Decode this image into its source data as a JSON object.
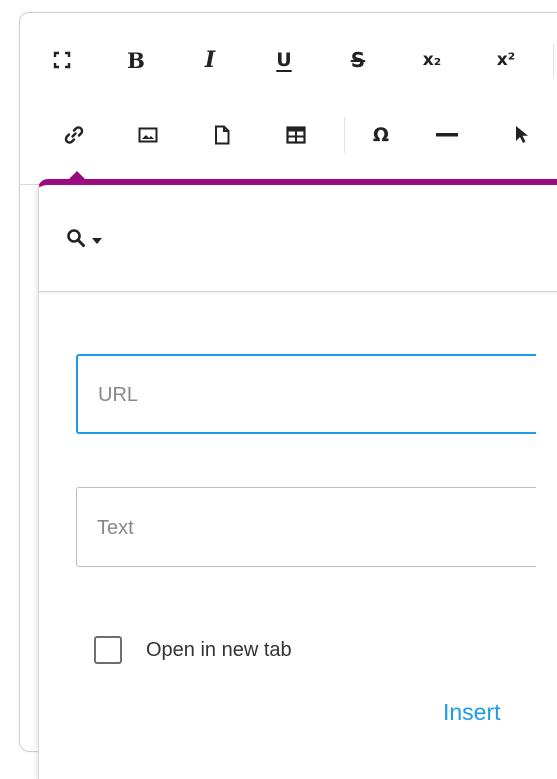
{
  "toolbar": {
    "row1": [
      {
        "icon": "fullscreen-icon",
        "label": ""
      },
      {
        "icon": "bold-icon",
        "label": "B"
      },
      {
        "icon": "italic-icon",
        "label": "I"
      },
      {
        "icon": "underline-icon",
        "label": "U"
      },
      {
        "icon": "strikethrough-icon",
        "label": "S"
      },
      {
        "icon": "subscript-icon",
        "label": "x₂"
      },
      {
        "icon": "superscript-icon",
        "label": "x²"
      }
    ],
    "row2": [
      {
        "icon": "link-icon"
      },
      {
        "icon": "image-icon"
      },
      {
        "icon": "file-icon"
      },
      {
        "icon": "table-icon"
      },
      {
        "icon": "special-char-icon",
        "label": "Ω"
      },
      {
        "icon": "horizontal-line-icon"
      },
      {
        "icon": "cursor-pointer-icon"
      }
    ]
  },
  "link_popup": {
    "accent_color": "#9a0c7e",
    "search_icon": "search-icon",
    "dropdown_icon": "caret-down-icon",
    "url_field": {
      "placeholder": "URL",
      "value": ""
    },
    "text_field": {
      "placeholder": "Text",
      "value": ""
    },
    "open_new_tab": {
      "label": "Open in new tab",
      "checked": false
    },
    "insert_label": "Insert",
    "focus_color": "#1e9be8"
  }
}
